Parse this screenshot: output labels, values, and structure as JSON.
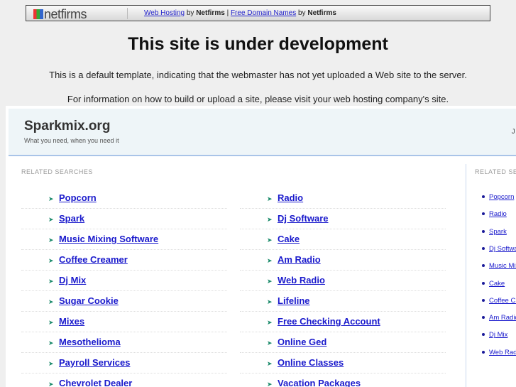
{
  "bar": {
    "logo": "netfirms",
    "link1": "Web Hosting",
    "by": "by",
    "brand": "Netfirms",
    "pipe": "|",
    "link2": "Free Domain Names"
  },
  "title": "This site is under development",
  "info1": "This is a default template, indicating that the webmaster has not yet uploaded a Web site to the server.",
  "info2": "For information on how to build or upload a site, please visit your web hosting company's site.",
  "site": {
    "name": "Sparkmix.org",
    "tagline": "What you need, when you need it",
    "date": "J"
  },
  "related_label": "RELATED SEARCHES",
  "left": [
    "Popcorn",
    "Spark",
    "Music Mixing Software",
    "Coffee Creamer",
    "Dj Mix",
    "Sugar Cookie",
    "Mixes",
    "Mesothelioma",
    "Payroll Services",
    "Chevrolet Dealer"
  ],
  "right": [
    "Radio",
    "Dj Software",
    "Cake",
    "Am Radio",
    "Web Radio",
    "Lifeline",
    "Free Checking Account",
    "Online Ged",
    "Online Classes",
    "Vacation Packages"
  ],
  "side": [
    "Popcorn",
    "Radio",
    "Spark",
    "Dj Software",
    "Music Mixing Software",
    "Cake",
    "Coffee Creamer",
    "Am Radio",
    "Dj Mix",
    "Web Radio"
  ]
}
